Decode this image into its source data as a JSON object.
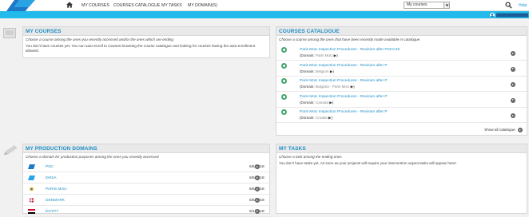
{
  "nav": {
    "items": [
      "MY COURSES",
      "COURSES CATALOGUE",
      "MY TASKS",
      "MY DOMAIN(S)"
    ],
    "select_value": "My courses",
    "help": "Help"
  },
  "my_courses": {
    "title": "MY COURSES",
    "subtitle": "Choose a course among the ones you recently accessed and/or the ones which are ending",
    "message": "You don't have courses yet. You can auto-enroll to courses browsing the course catalogue and looking for courses having the auto-enrollment allowed."
  },
  "catalogue": {
    "title": "COURSES CATALOGUE",
    "subtitle": "Choose a course among the ones that have been recently made available in catalogue",
    "domain_label": "(Domain:",
    "courses": [
      {
        "title": "Paris MoU Inspection Procedures - Revision after PSCC49",
        "domain": "Paris MoU"
      },
      {
        "title": "Paris MoU Inspection Procedures - Revision after P",
        "domain": "Belgium"
      },
      {
        "title": "Paris MoU Inspection Procedures - Revision after P",
        "domain": "Bulgaria - Paris MoU"
      },
      {
        "title": "Paris MoU Inspection Procedures - Revision after P",
        "domain": "Canada"
      },
      {
        "title": "Paris MoU Inspection Procedures - Revision after P",
        "domain": "Croatia"
      }
    ],
    "show_all": "Show all catalogue"
  },
  "production": {
    "title": "MY PRODUCTION DOMAINS",
    "subtitle": "Choose a domain for production purposes among the ones you recently accessed",
    "domains": [
      {
        "name": "PSC",
        "date": "6/6/2018",
        "flag": "psc"
      },
      {
        "name": "EMSA",
        "date": "6/6/2018",
        "flag": "emsa"
      },
      {
        "name": "PARIS MOU",
        "date": "6/6/2018",
        "flag": "parismou"
      },
      {
        "name": "DENMARK",
        "date": "5/6/2018",
        "flag": "denmark"
      },
      {
        "name": "EGYPT",
        "date": "5/1/2018",
        "flag": "egypt"
      }
    ]
  },
  "tasks": {
    "title": "MY TASKS",
    "subtitle": "Choose a task among the ending ones",
    "message": "You don't have tasks yet. As soon as your projects will require your intervention urgent tasks will appear here!"
  },
  "colors": {
    "accent": "#1d8fc6",
    "bar": "#22b9eb",
    "go": "#666666",
    "bullet": "#3fa56a"
  }
}
